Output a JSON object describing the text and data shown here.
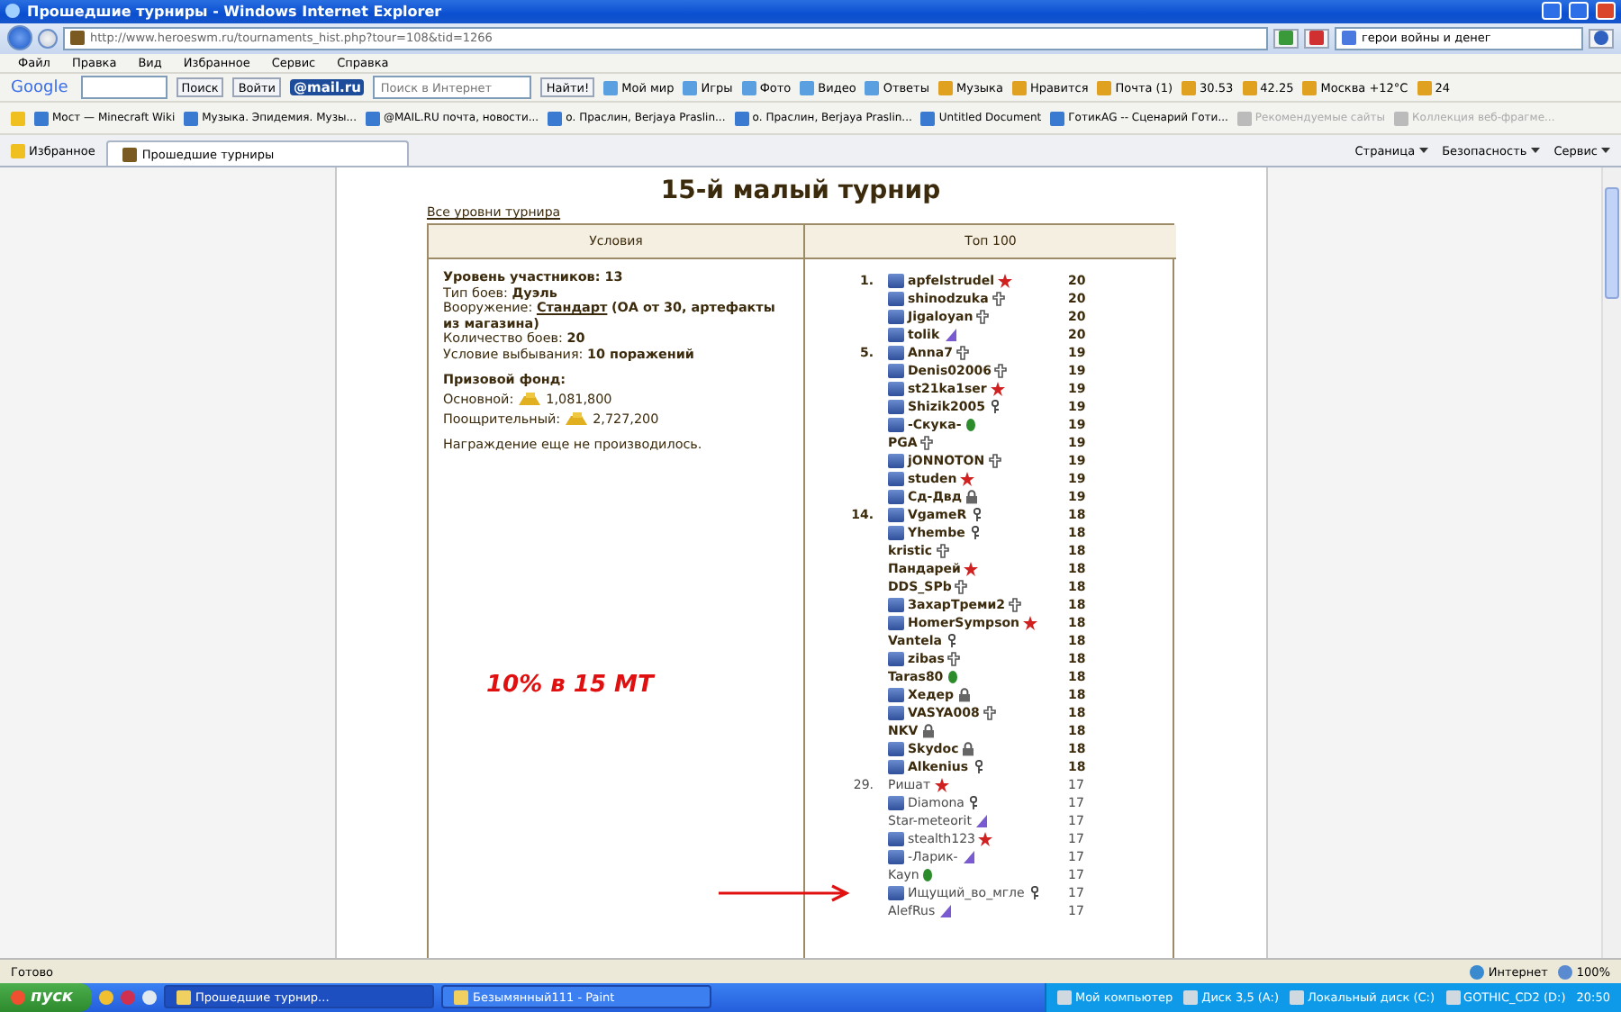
{
  "window": {
    "title": "Прошедшие турниры - Windows Internet Explorer"
  },
  "address": {
    "url": "http://www.heroeswm.ru/tournaments_hist.php?tour=108&tid=1266",
    "search": "герои войны и денег"
  },
  "menu": [
    "Файл",
    "Правка",
    "Вид",
    "Избранное",
    "Сервис",
    "Справка"
  ],
  "toolbar": {
    "google_logo": "Google",
    "search_button": "Поиск",
    "login_button": "Войти",
    "mail_logo": "@mail.ru",
    "placeholder": "Поиск в Интернет",
    "find_button": "Найти!",
    "links": [
      "Мой мир",
      "Игры",
      "Фото",
      "Видео",
      "Ответы"
    ],
    "widgets": [
      "Музыка",
      "Нравится",
      "Почта (1)",
      "30.53",
      "42.25",
      "Москва +12°C",
      "24"
    ]
  },
  "favorites": [
    {
      "label": "Мост — Minecraft Wiki",
      "disabled": false
    },
    {
      "label": "Музыка. Эпидемия. Музы...",
      "disabled": false
    },
    {
      "label": "@MAIL.RU почта, новости...",
      "disabled": false
    },
    {
      "label": "о. Праслин, Berjaya Praslin...",
      "disabled": false
    },
    {
      "label": "о. Праслин, Berjaya Praslin...",
      "disabled": false
    },
    {
      "label": "Untitled Document",
      "disabled": false
    },
    {
      "label": "ГотикАG -- Сценарий Готи...",
      "disabled": false
    },
    {
      "label": "Рекомендуемые сайты",
      "disabled": true
    },
    {
      "label": "Коллекция веб-фрагме...",
      "disabled": true
    }
  ],
  "tabs": {
    "favorites_button": "Избранное",
    "tab": "Прошедшие турниры",
    "commands": [
      "Страница",
      "Безопасность",
      "Сервис"
    ]
  },
  "page": {
    "heading": "15-й малый турнир",
    "levels_link": "Все уровни турнира",
    "columns": [
      "Условия",
      "Топ 100"
    ],
    "conditions": [
      {
        "kind": "heading",
        "text": "Уровень участников: 13"
      },
      {
        "kind": "line",
        "text": "Тип боев: **Дуэль**"
      },
      {
        "kind": "link_line",
        "text": "Вооружение:",
        "link": "Стандарт",
        "after": "(ОА от 30, артефакты из магазина)"
      },
      {
        "kind": "line",
        "text": "Количество боев: **20**"
      },
      {
        "kind": "line",
        "text": "Условие выбывания: **10 поражений**"
      }
    ],
    "prize_title": "Призовой фонд:",
    "prizes": [
      {
        "label": "Основной:",
        "amount": "1,081,800"
      },
      {
        "label": "Поощрительный:",
        "amount": "2,727,200"
      }
    ],
    "note": "Награждение еще не производилось.",
    "annotation": "10% в 15 МТ",
    "ranking": [
      {
        "rank": "1.",
        "name": "apfelstrudel",
        "clan": true,
        "kind": "red",
        "score": "20",
        "bold": true,
        "marked": false
      },
      {
        "name": "shinodzuka",
        "clan": true,
        "kind": "cross",
        "score": "20",
        "bold": true,
        "marked": false
      },
      {
        "name": "Jigaloyan",
        "clan": true,
        "kind": "cross",
        "score": "20",
        "bold": true,
        "marked": false
      },
      {
        "name": "tolik",
        "clan": true,
        "kind": "purple",
        "score": "20",
        "bold": true,
        "marked": false
      },
      {
        "rank": "5.",
        "name": "Anna7",
        "clan": true,
        "kind": "cross",
        "score": "19",
        "bold": true,
        "marked": false
      },
      {
        "name": "Denis02006",
        "clan": true,
        "kind": "cross",
        "score": "19",
        "bold": true,
        "marked": false
      },
      {
        "name": "st21ka1ser",
        "clan": true,
        "kind": "red",
        "score": "19",
        "bold": true,
        "marked": false
      },
      {
        "name": "Shizik2005",
        "clan": true,
        "kind": "key",
        "score": "19",
        "bold": true,
        "marked": false
      },
      {
        "name": "-Скука-",
        "clan": true,
        "kind": "green",
        "score": "19",
        "bold": true,
        "marked": false
      },
      {
        "name": "PGA",
        "clan": false,
        "kind": "cross",
        "score": "19",
        "bold": true,
        "marked": false
      },
      {
        "name": "jONNOTON",
        "clan": true,
        "kind": "cross",
        "score": "19",
        "bold": true,
        "marked": false
      },
      {
        "name": "studen",
        "clan": true,
        "kind": "red",
        "score": "19",
        "bold": true,
        "marked": false
      },
      {
        "name": "Сд-Двд",
        "clan": true,
        "kind": "lock",
        "score": "19",
        "bold": true,
        "marked": false
      },
      {
        "rank": "14.",
        "name": "VgameR",
        "clan": true,
        "kind": "key",
        "score": "18",
        "bold": true,
        "marked": false
      },
      {
        "name": "Yhembe",
        "clan": true,
        "kind": "key",
        "score": "18",
        "bold": true,
        "marked": false
      },
      {
        "name": "kristic",
        "clan": false,
        "kind": "cross",
        "score": "18",
        "bold": true,
        "marked": false
      },
      {
        "name": "Пандарей",
        "clan": false,
        "kind": "red",
        "score": "18",
        "bold": true,
        "marked": false
      },
      {
        "name": "DDS_SPb",
        "clan": false,
        "kind": "cross",
        "score": "18",
        "bold": true,
        "marked": false
      },
      {
        "name": "ЗахарТреми2",
        "clan": true,
        "kind": "cross",
        "score": "18",
        "bold": true,
        "marked": false
      },
      {
        "name": "HomerSympson",
        "clan": true,
        "kind": "red",
        "score": "18",
        "bold": true,
        "marked": false
      },
      {
        "name": "Vantela",
        "clan": false,
        "kind": "key",
        "score": "18",
        "bold": true,
        "marked": false
      },
      {
        "name": "zibas",
        "clan": true,
        "kind": "cross",
        "score": "18",
        "bold": true,
        "marked": false
      },
      {
        "name": "Taras80",
        "clan": false,
        "kind": "green",
        "score": "18",
        "bold": true,
        "marked": false
      },
      {
        "name": "Хедер",
        "clan": true,
        "kind": "lock",
        "score": "18",
        "bold": true,
        "marked": false
      },
      {
        "name": "VASYA008",
        "clan": true,
        "kind": "cross",
        "score": "18",
        "bold": true,
        "marked": false
      },
      {
        "name": "NKV",
        "clan": false,
        "kind": "lock",
        "score": "18",
        "bold": true,
        "marked": false
      },
      {
        "name": "Skydoc",
        "clan": true,
        "kind": "lock",
        "score": "18",
        "bold": true,
        "marked": false
      },
      {
        "name": "Alkenius",
        "clan": true,
        "kind": "key",
        "score": "18",
        "bold": true,
        "marked": false
      },
      {
        "rank": "29.",
        "name": "Ришат",
        "clan": false,
        "kind": "red",
        "score": "17",
        "bold": false,
        "marked": false
      },
      {
        "name": "Diamona",
        "clan": true,
        "kind": "key",
        "score": "17",
        "bold": false,
        "marked": false
      },
      {
        "name": "Star-meteorit",
        "clan": false,
        "kind": "purple",
        "score": "17",
        "bold": false,
        "marked": false
      },
      {
        "name": "stealth123",
        "clan": true,
        "kind": "red",
        "score": "17",
        "bold": false,
        "marked": false
      },
      {
        "name": "-Ларик-",
        "clan": true,
        "kind": "purple",
        "score": "17",
        "bold": false,
        "marked": false
      },
      {
        "name": "Kayn",
        "clan": false,
        "kind": "green",
        "score": "17",
        "bold": false,
        "marked": false
      },
      {
        "name": "Ищущий_во_мгле",
        "clan": true,
        "kind": "key",
        "score": "17",
        "bold": false,
        "marked": true
      },
      {
        "name": "AlefRus",
        "clan": false,
        "kind": "purple",
        "score": "17",
        "bold": false,
        "marked": false
      }
    ]
  },
  "status_bar": {
    "text": "Готово",
    "zone": "Интернет",
    "zoom": "100%"
  },
  "taskbar": {
    "start": "пуск",
    "tasks": [
      {
        "label": "Прошедшие турнир...",
        "selected": true
      },
      {
        "label": "Безымянный111 - Paint",
        "selected": false
      }
    ],
    "tray": [
      "Мой компьютер",
      "Диск 3,5 (A:)",
      "Локальный диск (C:)",
      "GOTHIC_CD2 (D:)"
    ],
    "clock": "20:50"
  }
}
